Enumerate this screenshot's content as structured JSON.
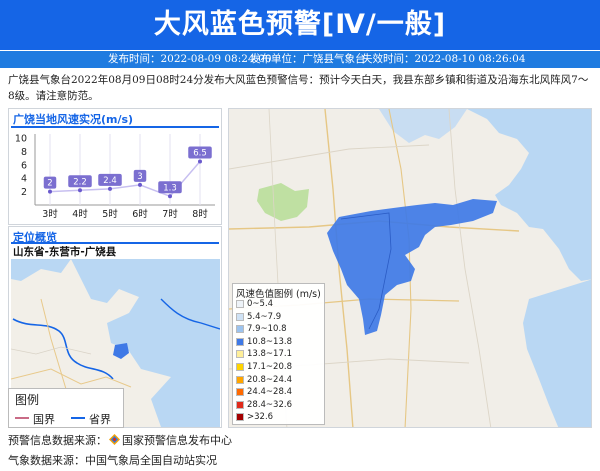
{
  "header": {
    "title": "大风蓝色预警[Ⅳ/一般]",
    "issue_time": "发布时间：2022-08-09 08:24:00",
    "issuer": "发布单位：广饶县气象台",
    "expire_time": "失效时间：2022-08-10 08:26:04"
  },
  "description": "广饶县气象台2022年08月09日08时24分发布大风蓝色预警信号：预计今天白天，我县东部乡镇和街道及沿海东北风阵风7～8级。请注意防范。",
  "wind_panel": {
    "title": "广饶当地风速实况(m/s)"
  },
  "chart_data": {
    "type": "line",
    "title": "广饶当地风速实况(m/s)",
    "categories": [
      "3时",
      "4时",
      "5时",
      "6时",
      "7时",
      "8时"
    ],
    "values": [
      2,
      2.2,
      2.4,
      3,
      1.3,
      6.5
    ],
    "data_labels": [
      "2",
      "2.2",
      "2.4",
      "3",
      "1.3",
      "6.5"
    ],
    "yticks": [
      "2",
      "4",
      "6",
      "8",
      "10"
    ],
    "ylim": [
      0,
      10
    ],
    "color": "#c7bff0",
    "label_color": "#6a5acd"
  },
  "location": {
    "title": "定位概览",
    "region": "山东省-东营市-广饶县"
  },
  "mini_legend": {
    "title": "图例",
    "items": [
      {
        "label": "国界",
        "color": "#c96b86"
      },
      {
        "label": "省界",
        "color": "#1565e6"
      }
    ]
  },
  "color_legend": {
    "title": "风速色值图例 (m/s)",
    "items": [
      {
        "label": "0~5.4",
        "color": "#eef3f8"
      },
      {
        "label": "5.4~7.9",
        "color": "#cfe2f5"
      },
      {
        "label": "7.9~10.8",
        "color": "#9cc3ee"
      },
      {
        "label": "10.8~13.8",
        "color": "#3f79e6"
      },
      {
        "label": "13.8~17.1",
        "color": "#ffef99"
      },
      {
        "label": "17.1~20.8",
        "color": "#ffd400"
      },
      {
        "label": "20.8~24.4",
        "color": "#ffa500"
      },
      {
        "label": "24.4~28.4",
        "color": "#ff6a00"
      },
      {
        "label": "28.4~32.6",
        "color": "#e02a1a"
      },
      {
        "label": ">32.6",
        "color": "#a30000"
      }
    ]
  },
  "footer": {
    "source_label": "预警信息数据来源：",
    "source_name": "国家预警信息发布中心",
    "weather_label": "气象数据来源：",
    "weather_name": "中国气象局全国自动站实况"
  },
  "colors": {
    "header_bg": "#1565e6",
    "warning_area": "#3f79e6",
    "sea": "#b9d7f3"
  }
}
